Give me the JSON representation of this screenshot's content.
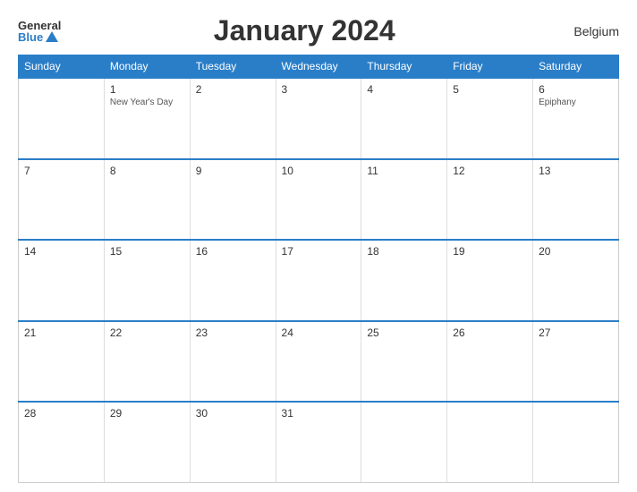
{
  "header": {
    "logo_general": "General",
    "logo_blue": "Blue",
    "title": "January 2024",
    "country": "Belgium"
  },
  "calendar": {
    "days_of_week": [
      "Sunday",
      "Monday",
      "Tuesday",
      "Wednesday",
      "Thursday",
      "Friday",
      "Saturday"
    ],
    "weeks": [
      [
        {
          "day": "",
          "holiday": "",
          "empty": true
        },
        {
          "day": "1",
          "holiday": "New Year's Day",
          "empty": false
        },
        {
          "day": "2",
          "holiday": "",
          "empty": false
        },
        {
          "day": "3",
          "holiday": "",
          "empty": false
        },
        {
          "day": "4",
          "holiday": "",
          "empty": false
        },
        {
          "day": "5",
          "holiday": "",
          "empty": false
        },
        {
          "day": "6",
          "holiday": "Epiphany",
          "empty": false
        }
      ],
      [
        {
          "day": "7",
          "holiday": "",
          "empty": false
        },
        {
          "day": "8",
          "holiday": "",
          "empty": false
        },
        {
          "day": "9",
          "holiday": "",
          "empty": false
        },
        {
          "day": "10",
          "holiday": "",
          "empty": false
        },
        {
          "day": "11",
          "holiday": "",
          "empty": false
        },
        {
          "day": "12",
          "holiday": "",
          "empty": false
        },
        {
          "day": "13",
          "holiday": "",
          "empty": false
        }
      ],
      [
        {
          "day": "14",
          "holiday": "",
          "empty": false
        },
        {
          "day": "15",
          "holiday": "",
          "empty": false
        },
        {
          "day": "16",
          "holiday": "",
          "empty": false
        },
        {
          "day": "17",
          "holiday": "",
          "empty": false
        },
        {
          "day": "18",
          "holiday": "",
          "empty": false
        },
        {
          "day": "19",
          "holiday": "",
          "empty": false
        },
        {
          "day": "20",
          "holiday": "",
          "empty": false
        }
      ],
      [
        {
          "day": "21",
          "holiday": "",
          "empty": false
        },
        {
          "day": "22",
          "holiday": "",
          "empty": false
        },
        {
          "day": "23",
          "holiday": "",
          "empty": false
        },
        {
          "day": "24",
          "holiday": "",
          "empty": false
        },
        {
          "day": "25",
          "holiday": "",
          "empty": false
        },
        {
          "day": "26",
          "holiday": "",
          "empty": false
        },
        {
          "day": "27",
          "holiday": "",
          "empty": false
        }
      ],
      [
        {
          "day": "28",
          "holiday": "",
          "empty": false
        },
        {
          "day": "29",
          "holiday": "",
          "empty": false
        },
        {
          "day": "30",
          "holiday": "",
          "empty": false
        },
        {
          "day": "31",
          "holiday": "",
          "empty": false
        },
        {
          "day": "",
          "holiday": "",
          "empty": true
        },
        {
          "day": "",
          "holiday": "",
          "empty": true
        },
        {
          "day": "",
          "holiday": "",
          "empty": true
        }
      ]
    ]
  }
}
